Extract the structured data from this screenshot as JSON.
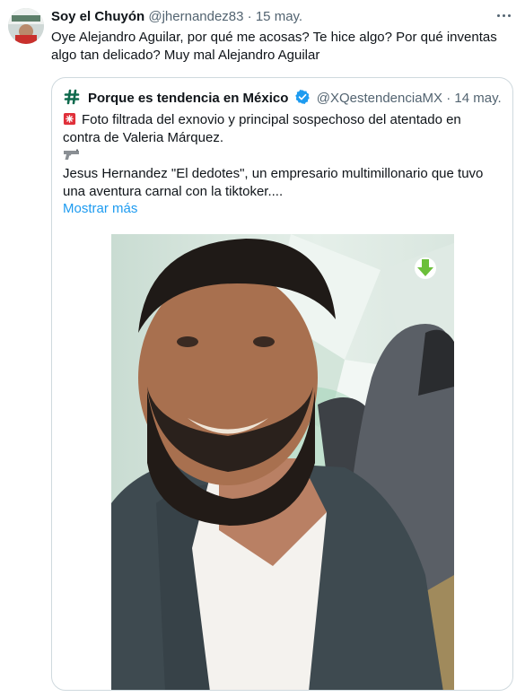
{
  "tweet": {
    "author_name": "Soy el Chuyón",
    "handle": "@jhernandez83",
    "separator": "·",
    "date": "15 may.",
    "text": "Oye Alejandro Aguilar, por qué me acosas? Te hice algo? Por qué inventas algo tan delicado? Muy mal Alejandro Aguilar",
    "avatar_icon": "profile-photo"
  },
  "quote": {
    "author_name": "Porque es tendencia en México",
    "handle": "@XQestendenciaMX",
    "separator": "·",
    "date": "14 may.",
    "line1": "Foto filtrada del exnovio y principal sospechoso del atentado en",
    "line2": "contra de Valeria Márquez.",
    "line3": "Jesus Hernandez \"El dedotes\", un empresario multimillonario que tuvo",
    "line4": "una aventura carnal con la tiktoker....",
    "show_more": "Mostrar más",
    "icons": [
      "hashtag-icon",
      "verified-badge-icon",
      "siren-emoji-icon",
      "pistol-emoji-icon",
      "download-arrow-icon"
    ]
  },
  "colors": {
    "text": "#0f1419",
    "secondary": "#536471",
    "link": "#1d9bf0",
    "border": "#cfd9de",
    "hashtag_green": "#0e6a4d"
  }
}
